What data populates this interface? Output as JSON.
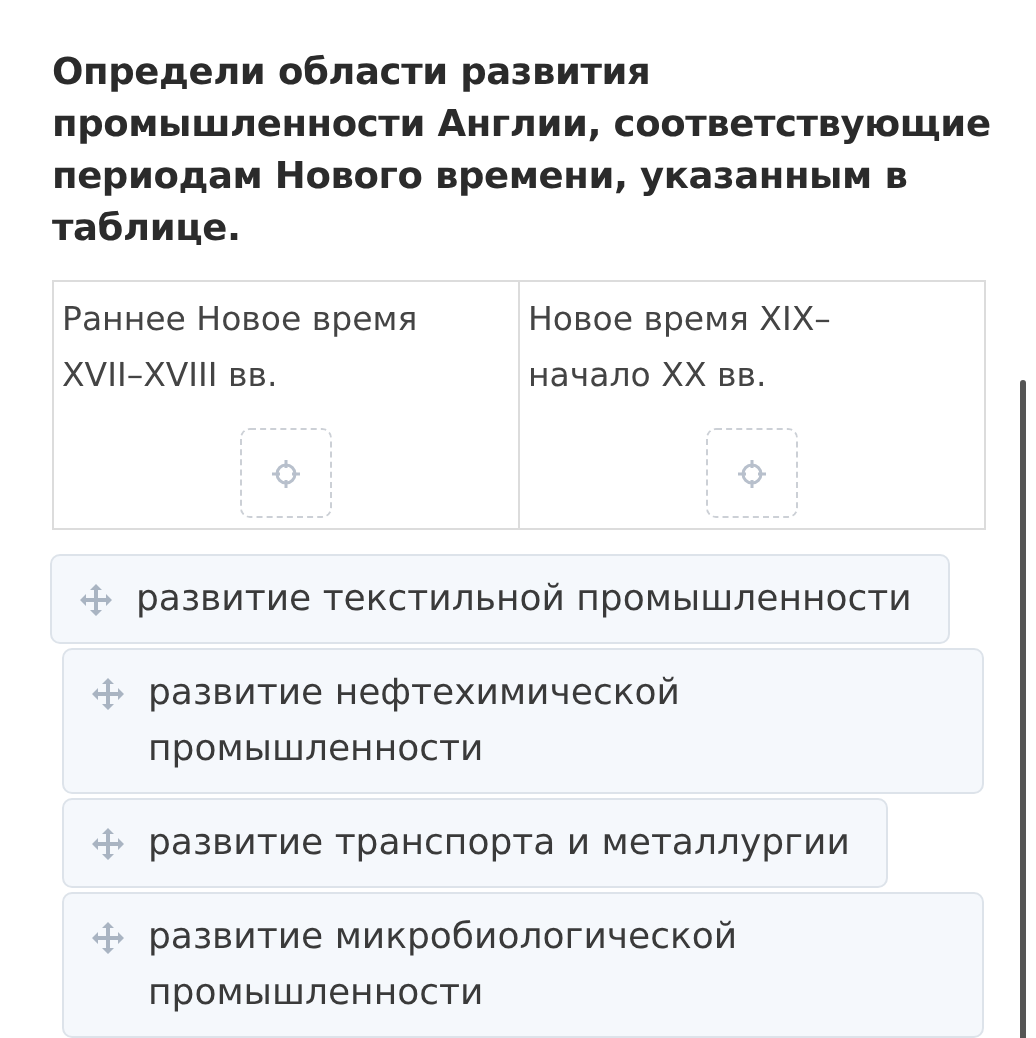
{
  "question": "Определи области развития промышленности Англии, соответствующие периодам Нового времени, указанным в таблице.",
  "table": {
    "columns": [
      {
        "heading": "Раннее Новое время XVII–XVIII вв."
      },
      {
        "heading": "Новое время XIX–начало XX вв."
      }
    ]
  },
  "cards": [
    {
      "text": "развитие текстильной промышленности"
    },
    {
      "text": "развитие нефтехимической промышленности"
    },
    {
      "text": "развитие транспорта и металлургии"
    },
    {
      "text": "развитие микробиологической промышленности"
    }
  ]
}
